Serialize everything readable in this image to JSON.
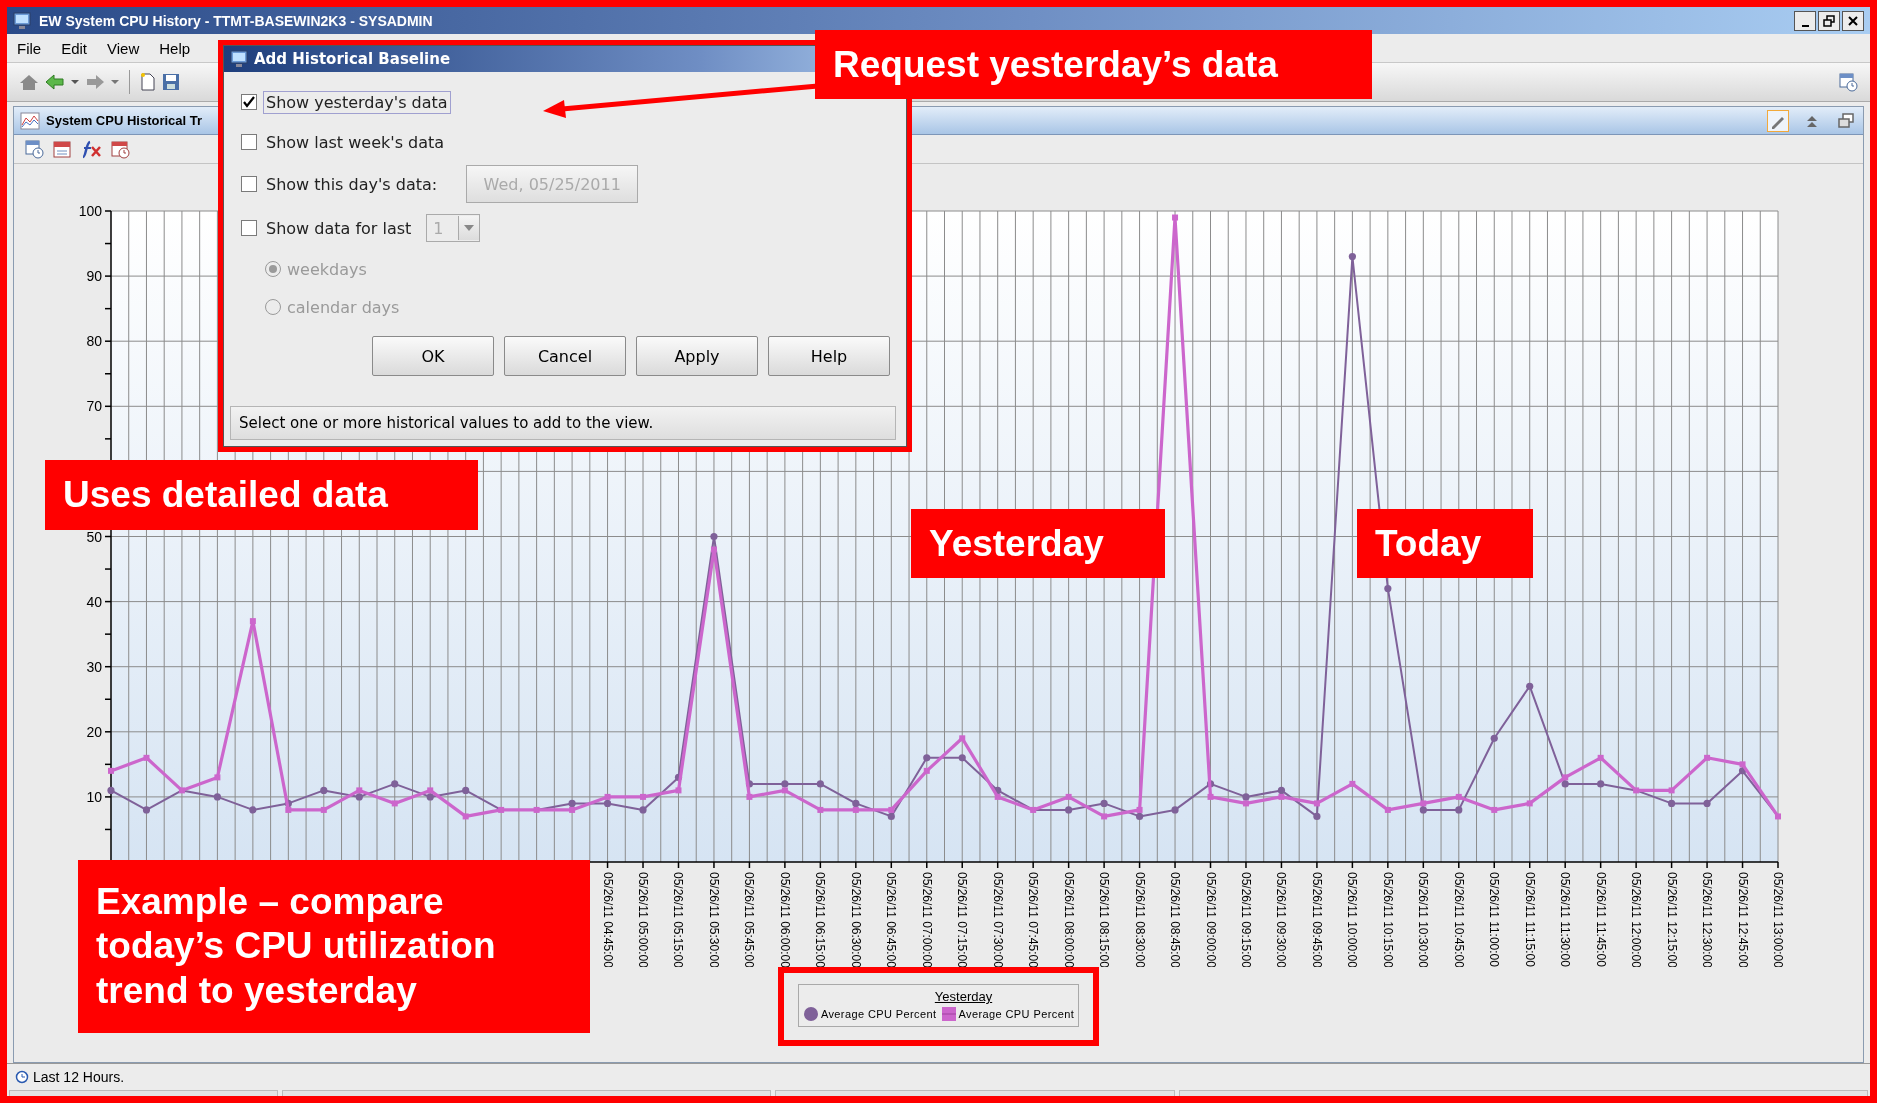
{
  "window": {
    "title": "EW System CPU History - TTMT-BASEWIN2K3 - SYSADMIN"
  },
  "menu": [
    {
      "label": "File"
    },
    {
      "label": "Edit"
    },
    {
      "label": "View"
    },
    {
      "label": "Help"
    }
  ],
  "panel": {
    "title": "System CPU Historical Tr",
    "tools": [
      {
        "kind": "edit",
        "highlighted": true
      },
      {
        "kind": "collapse",
        "highlighted": false
      },
      {
        "kind": "restore",
        "highlighted": false
      }
    ],
    "chart": {
      "legend_title": "Yesterday",
      "chart_data": {
        "type": "line",
        "categories": [
          null,
          null,
          null,
          null,
          null,
          null,
          null,
          null,
          null,
          null,
          null,
          null,
          null,
          null,
          "05/26/11 04:45:00",
          "05/26/11 05:00:00",
          "05/26/11 05:15:00",
          "05/26/11 05:30:00",
          "05/26/11 05:45:00",
          "05/26/11 06:00:00",
          "05/26/11 06:15:00",
          "05/26/11 06:30:00",
          "05/26/11 06:45:00",
          "05/26/11 07:00:00",
          "05/26/11 07:15:00",
          "05/26/11 07:30:00",
          "05/26/11 07:45:00",
          "05/26/11 08:00:00",
          "05/26/11 08:15:00",
          "05/26/11 08:30:00",
          "05/26/11 08:45:00",
          "05/26/11 09:00:00",
          "05/26/11 09:15:00",
          "05/26/11 09:30:00",
          "05/26/11 09:45:00",
          "05/26/11 10:00:00",
          "05/26/11 10:15:00",
          "05/26/11 10:30:00",
          "05/26/11 10:45:00",
          "05/26/11 11:00:00",
          "05/26/11 11:15:00",
          "05/26/11 11:30:00",
          "05/26/11 11:45:00",
          "05/26/11 12:00:00",
          "05/26/11 12:15:00",
          "05/26/11 12:30:00",
          "05/26/11 12:45:00",
          "05/26/11 13:00:00"
        ],
        "ylim": [
          0,
          100
        ],
        "grid": true,
        "yticks": [
          10,
          20,
          30,
          40,
          50,
          70,
          80,
          90,
          100
        ],
        "series": [
          {
            "name": "Average CPU Percent",
            "color": "#7f6199",
            "marker": "circle",
            "values": [
              11,
              8,
              11,
              10,
              8,
              9,
              11,
              10,
              12,
              10,
              11,
              8,
              8,
              9,
              9,
              8,
              13,
              50,
              12,
              12,
              12,
              9,
              7,
              16,
              16,
              11,
              8,
              8,
              9,
              7,
              8,
              12,
              10,
              11,
              7,
              93,
              42,
              8,
              8,
              19,
              27,
              12,
              12,
              11,
              9,
              9,
              14,
              7
            ]
          },
          {
            "name": "Average CPU Percent",
            "color": "#cc66cc",
            "marker": "square",
            "values": [
              14,
              16,
              11,
              13,
              37,
              8,
              8,
              11,
              9,
              11,
              7,
              8,
              8,
              8,
              10,
              10,
              11,
              48,
              10,
              11,
              8,
              8,
              8,
              14,
              19,
              10,
              8,
              10,
              7,
              8,
              99,
              10,
              9,
              10,
              9,
              12,
              8,
              9,
              10,
              8,
              9,
              13,
              16,
              11,
              11,
              16,
              15,
              7
            ]
          }
        ]
      }
    }
  },
  "dialog": {
    "title": "Add Historical Baseline",
    "rows": [
      {
        "kind": "checkbox",
        "label": "Show yesterday's data",
        "checked": true,
        "focused": true
      },
      {
        "kind": "checkbox",
        "label": "Show last week's data",
        "checked": false,
        "focused": false
      },
      {
        "kind": "date",
        "label": "Show this day's data:",
        "checked": false,
        "focused": false,
        "date": "Wed, 05/25/2011",
        "date_disabled": true
      },
      {
        "kind": "spinner",
        "label": "Show data for last",
        "checked": false,
        "focused": false,
        "value": "1",
        "value_disabled": true
      }
    ],
    "radios": [
      {
        "label": "weekdays",
        "selected": true,
        "disabled": true
      },
      {
        "label": "calendar days",
        "selected": false,
        "disabled": true
      }
    ],
    "buttons": [
      {
        "label": "OK"
      },
      {
        "label": "Cancel"
      },
      {
        "label": "Apply"
      },
      {
        "label": "Help"
      }
    ],
    "status": "Select one or more historical values to add to the view."
  },
  "status_bar": {
    "text": "Last 12 Hours."
  },
  "callouts": {
    "request": "Request yesterday’s data",
    "detailed": "Uses detailed data",
    "yesterday": "Yesterday",
    "today": "Today",
    "example": "Example – compare today’s CPU utilization trend to yesterday"
  }
}
